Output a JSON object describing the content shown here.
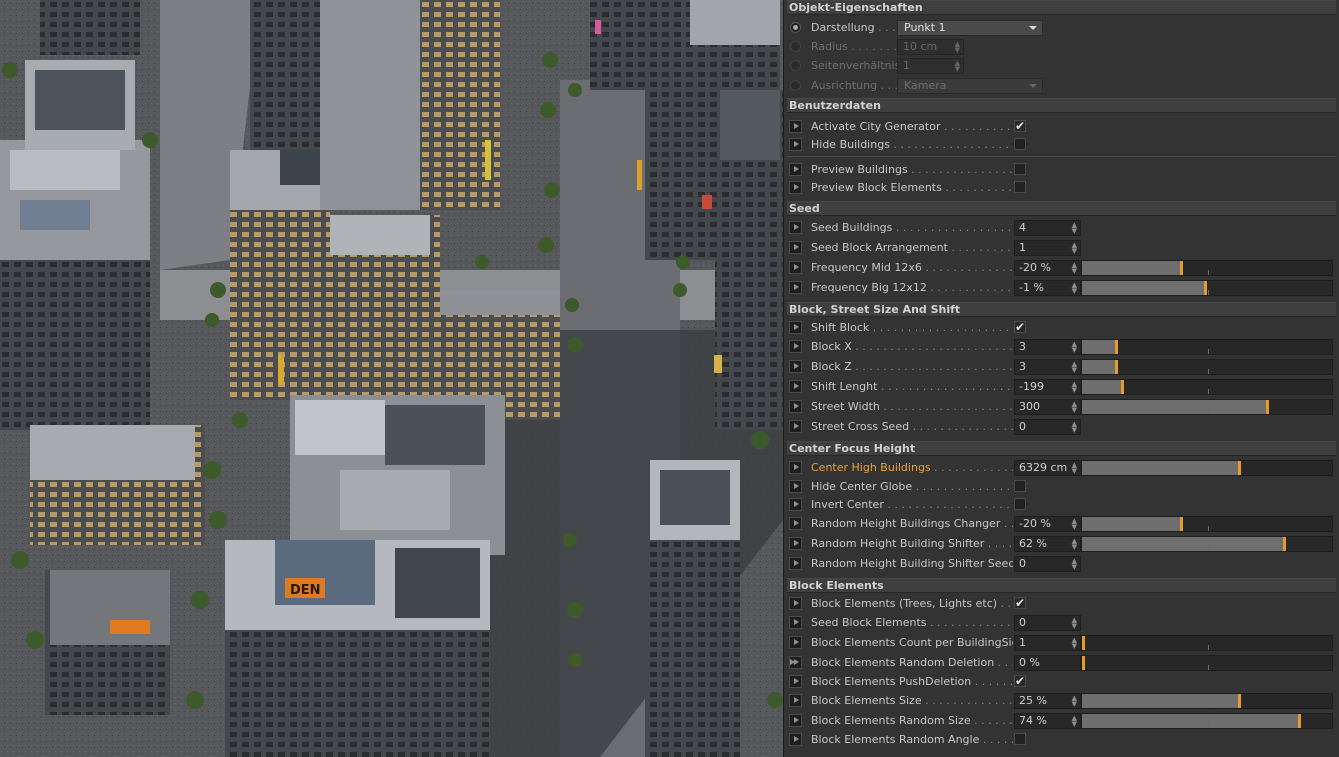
{
  "panel": {
    "title": "Objekt-Eigenschaften",
    "sections": {
      "user": "Benutzerdaten",
      "seed": "Seed",
      "block": "Block, Street Size And Shift",
      "center": "Center Focus Height",
      "elements": "Block Elements"
    },
    "object": {
      "darstellung": {
        "label": "Darstellung",
        "dots": " . . . ",
        "value": "Punkt 1"
      },
      "radius": {
        "label": "Radius",
        "dots": " . . . . . . . .",
        "value": "10 cm"
      },
      "seitenverhaeltnis": {
        "label": "Seitenverhältnis",
        "dots": " . .",
        "value": "1"
      },
      "ausrichtung": {
        "label": "Ausrichtung",
        "dots": " . . . . .",
        "value": "Kamera"
      }
    },
    "user": {
      "activate": {
        "label": "Activate City Generator",
        "dots": " . . . . . . . . . . . . . .",
        "checked": true,
        "mark": "✔"
      },
      "hide": {
        "label": "Hide Buildings",
        "dots": " . . . . . . . . . . . . . . . . . . . . . . . . .",
        "checked": false
      },
      "preview_buildings": {
        "label": "Preview Buildings",
        "dots": " . . . . . . . . . . . . . . . . . . . . . . .",
        "checked": false
      },
      "preview_block": {
        "label": "Preview Block Elements",
        "dots": " . . . . . . . . . . . . . . . . .",
        "checked": false
      }
    },
    "seed": {
      "seed_buildings": {
        "label": "Seed Buildings",
        "dots": " . . . . . . . . . . . . . . . . . . . . . .",
        "value": "4"
      },
      "seed_block": {
        "label": "Seed Block Arrangement",
        "dots": " . . . . . . . . . . . . . . . .",
        "value": "1"
      },
      "freq_mid": {
        "label": "Frequency Mid 12x6",
        "dots": " . . . . . . . . . . . . . . . . . . . . .",
        "value": "-20 %",
        "level": 0.4
      },
      "freq_big": {
        "label": "Frequency Big 12x12",
        "dots": " . . . . . . . . . . . . . . . . . . . .",
        "value": "-1 %",
        "level": 0.495
      }
    },
    "block": {
      "shift_block": {
        "label": "Shift Block",
        "dots": " . . . . . . . . . . . . . . . . . . . . . . . . . . .",
        "checked": true,
        "mark": "✔"
      },
      "block_x": {
        "label": "Block X",
        "dots": " . . . . . . . . . . . . . . . . . . . . . . . . . . . . . .",
        "value": "3",
        "level": 0.14
      },
      "block_z": {
        "label": "Block Z",
        "dots": " . . . . . . . . . . . . . . . . . . . . . . . . . . . . . .",
        "value": "3",
        "level": 0.14
      },
      "shift_length": {
        "label": "Shift Lenght",
        "dots": " . . . . . . . . . . . . . . . . . . . . . . . . .",
        "value": "-199",
        "level": 0.165
      },
      "street_width": {
        "label": "Street Width",
        "dots": " . . . . . . . . . . . . . . . . . . . . . . . . .",
        "value": "300",
        "level": 0.745
      },
      "street_cross": {
        "label": "Street Cross Seed",
        "dots": " . . . . . . . . . . . . . . . . . . . . .",
        "value": "0"
      }
    },
    "center": {
      "center_high": {
        "label": "Center High Buildings",
        "dots": " . . . . . . . . . . . . . . . . .",
        "value": "6329 cm",
        "level": 0.63
      },
      "hide_globe": {
        "label": "Hide Center Globe",
        "dots": " . . . . . . . . . . . . . . . . . . . . . .",
        "checked": false
      },
      "invert": {
        "label": "Invert Center",
        "dots": " . . . . . . . . . . . . . . . . . . . . . . . . . . .",
        "checked": false
      },
      "rand_changer": {
        "label": "Random Height Buildings Changer",
        "dots": " . . . . .",
        "value": "-20 %",
        "level": 0.4
      },
      "rand_shifter": {
        "label": "Random Height Building Shifter",
        "dots": " . . . . .",
        "value": "62 %",
        "level": 0.81
      },
      "rand_seed": {
        "label": "Random Height Building Shifter Seed",
        "dots": "",
        "value": "0"
      }
    },
    "elements": {
      "block_elements": {
        "label": "Block Elements (Trees, Lights etc)",
        "dots": " . . . . .",
        "checked": true,
        "mark": "✔"
      },
      "seed_elements": {
        "label": "Seed Block Elements",
        "dots": " . . . . . . . . . . . . . . . . .",
        "value": "0"
      },
      "count_per_side": {
        "label": "Block Elements Count per BuildingSide",
        "dots": "",
        "value": "1",
        "level": 0.0
      },
      "random_deletion": {
        "label": "Block Elements Random Deletion",
        "dots": " . . . . .",
        "value": "0 %",
        "level": 0.0
      },
      "push_deletion": {
        "label": "Block Elements PushDeletion",
        "dots": " . . . . . . . . . .",
        "checked": true,
        "mark": "✔"
      },
      "elements_size": {
        "label": "Block Elements Size",
        "dots": " . . . . . . . . . . . . . . . . . . .",
        "value": "25 %",
        "level": 0.63
      },
      "random_size": {
        "label": "Block Elements Random Size",
        "dots": " . . . . . . . . . .",
        "value": "74 %",
        "level": 0.87
      },
      "random_angle": {
        "label": "Block Elements Random Angle",
        "dots": " . . . . . . . . .",
        "checked": false
      }
    }
  },
  "viewport": {
    "signs": [
      "DEN"
    ]
  }
}
